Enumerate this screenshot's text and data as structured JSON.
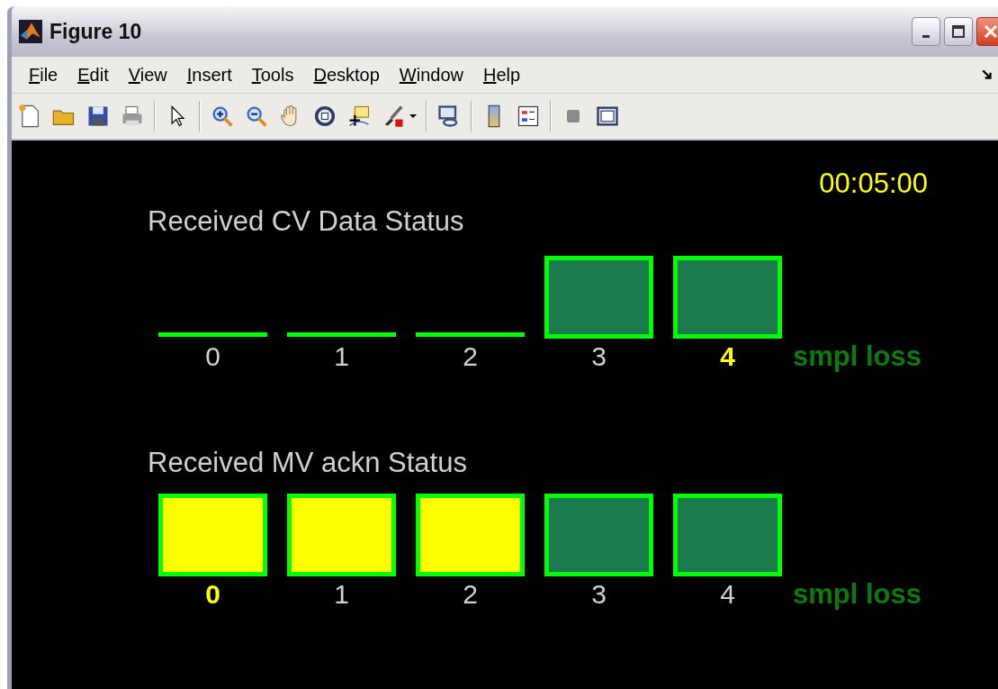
{
  "window": {
    "title": "Figure 10"
  },
  "menu": [
    "File",
    "Edit",
    "View",
    "Insert",
    "Tools",
    "Desktop",
    "Window",
    "Help"
  ],
  "clock": "00:05:00",
  "panels": [
    {
      "title": "Received CV Data Status",
      "legend": "smpl loss",
      "channels": [
        {
          "label": "0",
          "kind": "flat",
          "highlighted": false
        },
        {
          "label": "1",
          "kind": "flat",
          "highlighted": false
        },
        {
          "label": "2",
          "kind": "flat",
          "highlighted": false
        },
        {
          "label": "3",
          "kind": "box",
          "color": "#1b7a4e",
          "highlighted": false
        },
        {
          "label": "4",
          "kind": "box",
          "color": "#1b7a4e",
          "highlighted": true
        }
      ]
    },
    {
      "title": "Received MV ackn Status",
      "legend": "smpl loss",
      "channels": [
        {
          "label": "0",
          "kind": "box",
          "color": "#ffff00",
          "highlighted": true
        },
        {
          "label": "1",
          "kind": "box",
          "color": "#ffff00",
          "highlighted": false
        },
        {
          "label": "2",
          "kind": "box",
          "color": "#ffff00",
          "highlighted": false
        },
        {
          "label": "3",
          "kind": "box",
          "color": "#1b7a4e",
          "highlighted": false
        },
        {
          "label": "4",
          "kind": "box",
          "color": "#1b7a4e",
          "highlighted": false
        }
      ]
    }
  ]
}
